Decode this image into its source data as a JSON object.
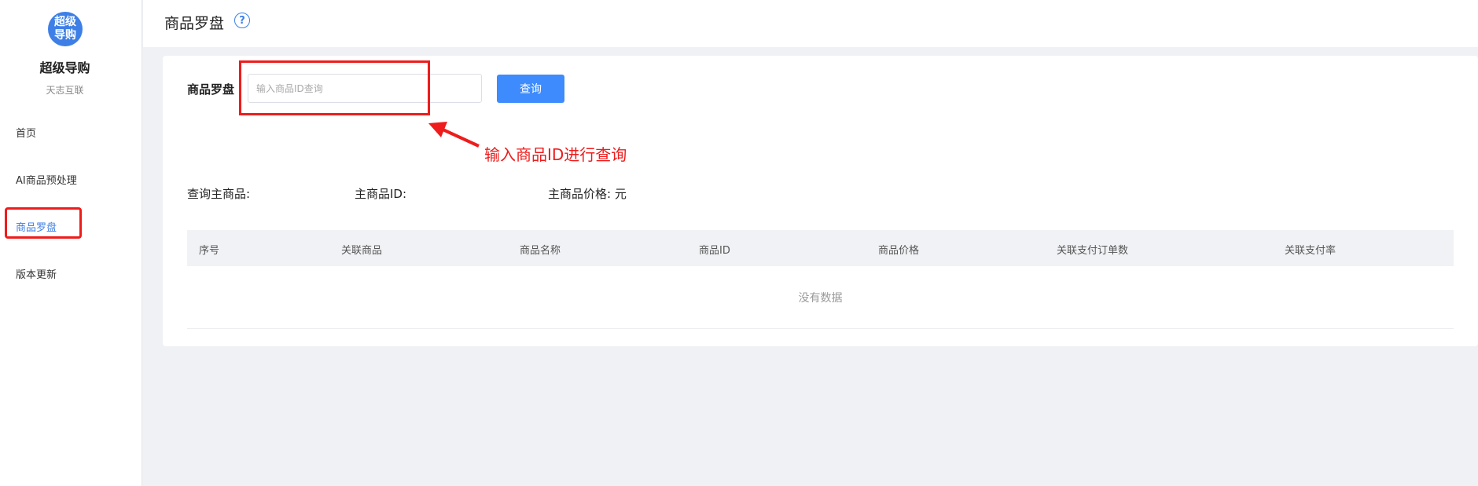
{
  "sidebar": {
    "logo_line1": "超级",
    "logo_line2": "导购",
    "app_name": "超级导购",
    "app_sub": "天志互联",
    "items": [
      {
        "label": "首页"
      },
      {
        "label": "AI商品预处理"
      },
      {
        "label": "商品罗盘"
      },
      {
        "label": "版本更新"
      }
    ],
    "active_index": 2
  },
  "header": {
    "title": "商品罗盘",
    "help_symbol": "?"
  },
  "search": {
    "label": "商品罗盘",
    "placeholder": "输入商品ID查询",
    "value": "",
    "button_label": "查询"
  },
  "annotation": {
    "text": "输入商品ID进行查询",
    "color": "#ee1c1c"
  },
  "info": {
    "main_product_label": "查询主商品:",
    "main_id_label": "主商品ID:",
    "main_price_label": "主商品价格: 元"
  },
  "table": {
    "columns": [
      "序号",
      "关联商品",
      "商品名称",
      "商品ID",
      "商品价格",
      "关联支付订单数",
      "关联支付率"
    ],
    "rows": [],
    "empty_text": "没有数据"
  },
  "colors": {
    "accent": "#3d8bfd",
    "annotation_red": "#ee1c1c",
    "background": "#f0f1f4"
  }
}
